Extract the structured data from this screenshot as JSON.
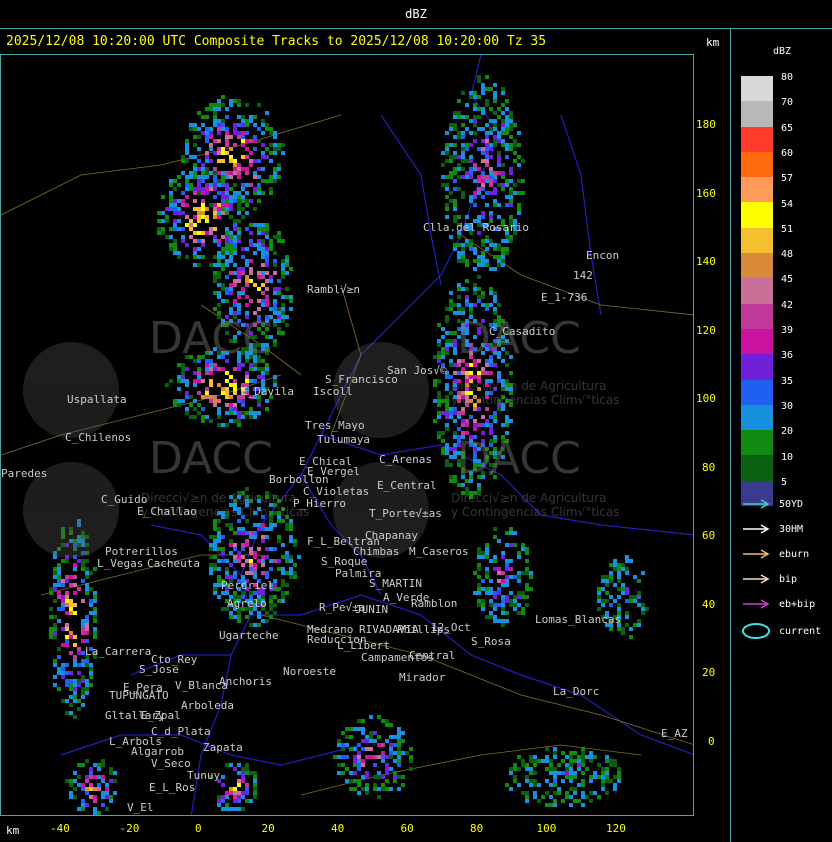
{
  "header": {
    "title": "dBZ"
  },
  "subtitle": "2025/12/08 10:20:00 UTC Composite Tracks to 2025/12/08 10:20:00 Tz 35",
  "axis_unit_top": "km",
  "axis_unit_bottom": "km",
  "y_ticks": [
    "180",
    "160",
    "140",
    "120",
    "100",
    "80",
    "60",
    "40",
    "20",
    "0"
  ],
  "x_ticks": [
    "-40",
    "-20",
    "0",
    "20",
    "40",
    "60",
    "80",
    "100",
    "120"
  ],
  "legend": {
    "title": "dBZ",
    "levels": [
      {
        "label": "80",
        "color": "#d8d8d8"
      },
      {
        "label": "70",
        "color": "#b8b8b8"
      },
      {
        "label": "65",
        "color": "#ff3a28"
      },
      {
        "label": "60",
        "color": "#ff6a10"
      },
      {
        "label": "57",
        "color": "#ff9a5a"
      },
      {
        "label": "54",
        "color": "#ffff00"
      },
      {
        "label": "51",
        "color": "#f5c030"
      },
      {
        "label": "48",
        "color": "#d88a38"
      },
      {
        "label": "45",
        "color": "#c8709a"
      },
      {
        "label": "42",
        "color": "#c03898"
      },
      {
        "label": "39",
        "color": "#cc10a0"
      },
      {
        "label": "36",
        "color": "#7020d8"
      },
      {
        "label": "35",
        "color": "#2060f0"
      },
      {
        "label": "30",
        "color": "#1890e0"
      },
      {
        "label": "20",
        "color": "#108a10"
      },
      {
        "label": "10",
        "color": "#0a6010"
      },
      {
        "label": "5",
        "color": "#3a3a90"
      }
    ],
    "tracks": [
      {
        "label": "50YD",
        "color": "#40d0d0"
      },
      {
        "label": "30HM",
        "color": "#ffffff"
      },
      {
        "label": "eburn",
        "color": "#f0c070"
      },
      {
        "label": "bip",
        "color": "#ffd8c0"
      },
      {
        "label": "eb+bip",
        "color": "#d040d0"
      },
      {
        "label": "current",
        "color": "#40e0e0"
      }
    ]
  },
  "places": [
    "Clla.del Rosario",
    "Encon",
    "142",
    "E_1-736",
    "Rambl√≥n",
    "C_Casadito",
    "San Jos√©",
    "S_Francisco",
    "Iscoll",
    "E_Davila",
    "Uspallata",
    "Tres_Mayo",
    "Tulumaya",
    "C_Chilenos",
    "E_Chical",
    "E_Vergel",
    "C_Arenas",
    "E_Central",
    "Borbollon",
    "C_Violetas",
    "P_Hierro",
    "Paredes",
    "C_Guido",
    "E_Challao",
    "F_L_Beltran",
    "T_Porte√±as",
    "Chapanay",
    "Potrerillos",
    "Chimbas",
    "M_Caseros",
    "L_Vegas",
    "Cacheuta",
    "S_Roque",
    "Palmira",
    "S_MARTIN",
    "Perdriel",
    "Agrelo",
    "R_Pe√±a",
    "JUNIN",
    "A_Verde",
    "Ramblon",
    "12_Oct",
    "Lomas_Blancas",
    "Ugarteche",
    "Medrano",
    "Reduccion",
    "RIVADAVIA",
    "Phillips",
    "La_Carrera",
    "Cto_Rey",
    "S_Jose",
    "L_Libert",
    "Campamentos",
    "Central",
    "S_Rosa",
    "E_Pera",
    "V_Blanca",
    "Anchoris",
    "Mirador",
    "TUPUNGATO",
    "Arboleda",
    "Gltallary",
    "E_Zpal",
    "L_Arbols",
    "C_d_Plata",
    "Algarrob",
    "Zapata",
    "V_Seco",
    "Tunuy",
    "Noroeste",
    "La_Dorc",
    "E_AZ",
    "E_L_Ros",
    "V_El"
  ],
  "watermark": {
    "brand": "DACC",
    "line1": "Direcci√≥n de Agricultura",
    "line2": "y Contingencias Clim√°ticas"
  },
  "image_description": "Radar composite reflectivity map over Mendoza region with scattered storm cells"
}
